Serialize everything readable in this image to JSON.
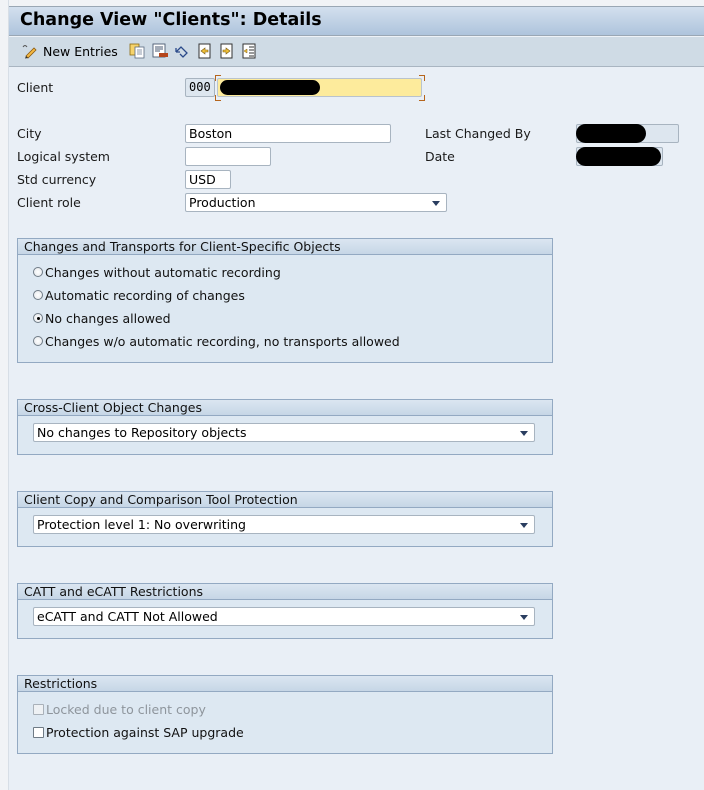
{
  "window": {
    "title": "Change View \"Clients\": Details"
  },
  "toolbar": {
    "new_entries_label": "New Entries",
    "icons": [
      "edit-pencil-icon",
      "copy-icon",
      "delete-icon",
      "undo-icon",
      "previous-entry-icon",
      "next-entry-icon",
      "select-all-icon"
    ]
  },
  "form": {
    "client_label": "Client",
    "client_number": "000",
    "client_name_redacted": true,
    "city_label": "City",
    "city_value": "Boston",
    "logical_system_label": "Logical system",
    "logical_system_value": "",
    "std_currency_label": "Std currency",
    "std_currency_value": "USD",
    "client_role_label": "Client role",
    "client_role_value": "Production",
    "last_changed_by_label": "Last Changed By",
    "last_changed_by_redacted": true,
    "date_label": "Date",
    "date_redacted": true
  },
  "groups": {
    "transports": {
      "title": "Changes and Transports for Client-Specific Objects",
      "options": [
        {
          "label": "Changes without automatic recording",
          "selected": false
        },
        {
          "label": "Automatic recording of changes",
          "selected": false
        },
        {
          "label": "No changes allowed",
          "selected": true
        },
        {
          "label": "Changes w/o automatic recording, no transports allowed",
          "selected": false
        }
      ]
    },
    "cross_client": {
      "title": "Cross-Client Object Changes",
      "value": "No changes to Repository objects"
    },
    "client_copy": {
      "title": "Client Copy and Comparison Tool Protection",
      "value": "Protection level 1: No overwriting"
    },
    "catt": {
      "title": "CATT and eCATT Restrictions",
      "value": "eCATT and CATT Not Allowed"
    },
    "restrictions": {
      "title": "Restrictions",
      "options": [
        {
          "label": "Locked due to client copy",
          "checked": false,
          "disabled": true
        },
        {
          "label": "Protection against SAP upgrade",
          "checked": false,
          "disabled": false
        }
      ]
    }
  },
  "colors": {
    "background": "#e9eff6",
    "title_bar": "#bccfe3",
    "group_fill": "#dde8f2",
    "group_border": "#93a9c2",
    "required_field": "#fdeb9c"
  }
}
